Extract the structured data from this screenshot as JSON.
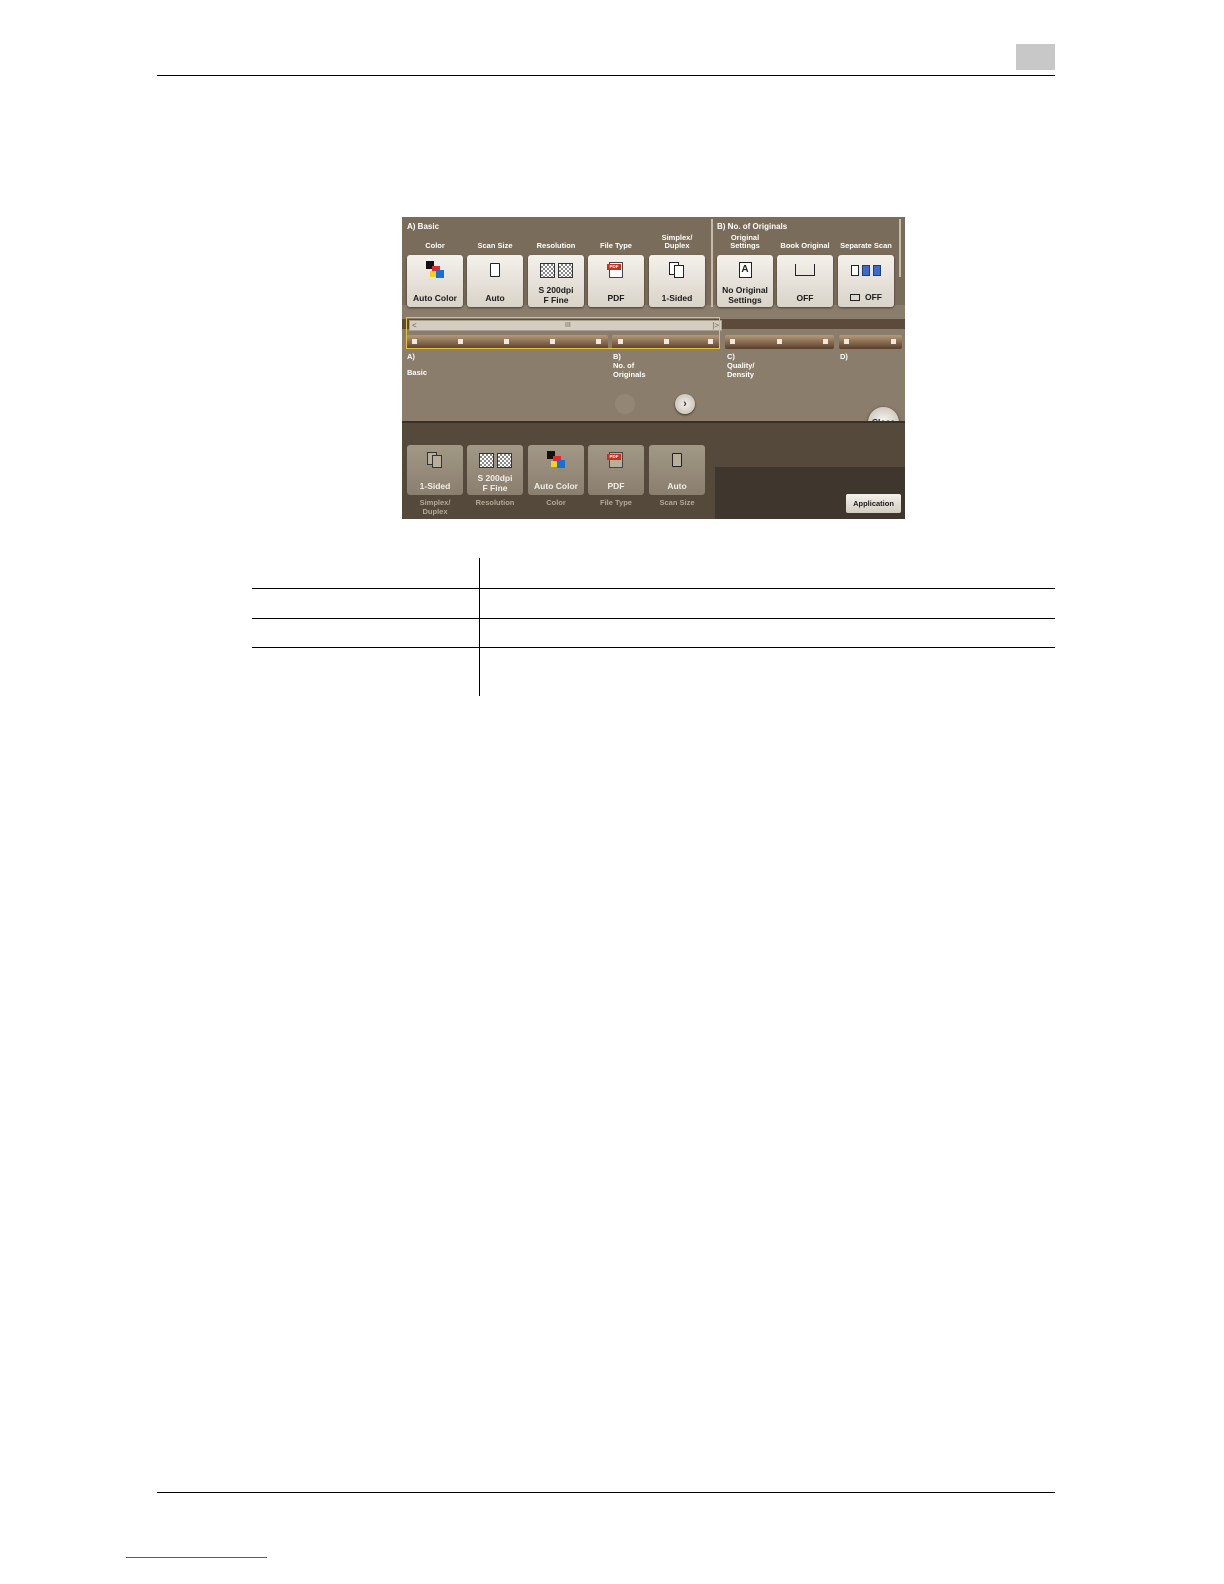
{
  "screen": {
    "sections": {
      "basic_title": "A)  Basic",
      "originals_title": "B)  No. of Originals"
    },
    "upper_buttons": [
      {
        "label": "Color",
        "value": "Auto Color",
        "icon": "color-icon"
      },
      {
        "label": "Scan Size",
        "value": "Auto",
        "icon": "document-icon"
      },
      {
        "label": "Resolution",
        "value_line1": "S 200dpi",
        "value_line2": "F Fine",
        "icon": "resolution-icon"
      },
      {
        "label": "File Type",
        "value": "PDF",
        "icon": "pdf-icon"
      },
      {
        "label_line1": "Simplex/",
        "label_line2": "Duplex",
        "value": "1-Sided",
        "icon": "duplex-icon"
      },
      {
        "label_line1": "Original",
        "label_line2": "Settings",
        "value_line1": "No Original",
        "value_line2": "Settings",
        "icon": "original-icon"
      },
      {
        "label": "Book Original",
        "value": "OFF",
        "icon": "book-icon"
      },
      {
        "label": "Separate Scan",
        "value": "OFF",
        "icon": "separate-scan-icon"
      }
    ],
    "nav_labels": {
      "a_line1": "A)",
      "a_line2": "Basic",
      "b_line1": "B)",
      "b_line2": "No. of",
      "b_line3": "Originals",
      "c_line1": "C)",
      "c_line2": "Quality/",
      "c_line3": "Density",
      "d_line1": "D)"
    },
    "scroll": {
      "left": "<",
      "grip": "III",
      "right": "|>"
    },
    "next_arrow": "›",
    "close": "Close",
    "lower_buttons": [
      {
        "value": "1-Sided",
        "caption_line1": "Simplex/",
        "caption_line2": "Duplex",
        "icon": "duplex-icon"
      },
      {
        "value_line1": "S 200dpi",
        "value_line2": "F Fine",
        "caption": "Resolution",
        "icon": "resolution-icon"
      },
      {
        "value": "Auto Color",
        "caption": "Color",
        "icon": "color-icon"
      },
      {
        "value": "PDF",
        "caption": "File Type",
        "icon": "pdf-icon"
      },
      {
        "value": "Auto",
        "caption": "Scan Size",
        "icon": "document-icon"
      }
    ],
    "application": "Application"
  }
}
